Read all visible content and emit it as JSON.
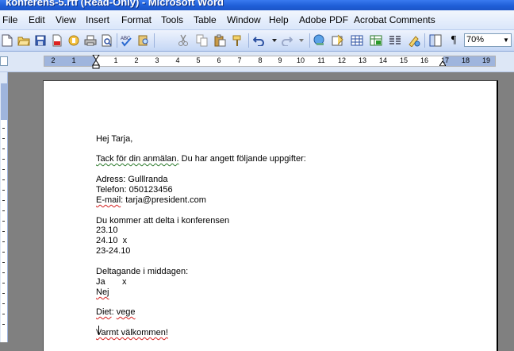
{
  "window": {
    "title": "konferens-5.rtf (Read-Only) - Microsoft Word"
  },
  "menu": {
    "items": [
      "File",
      "Edit",
      "View",
      "Insert",
      "Format",
      "Tools",
      "Table",
      "Window",
      "Help",
      "Adobe PDF",
      "Acrobat Comments"
    ]
  },
  "toolbar": {
    "zoom": "70%",
    "icons": [
      "new-doc-icon",
      "open-folder-icon",
      "save-icon",
      "pdf-icon",
      "permission-icon",
      "print-icon",
      "print-preview-icon",
      "spelling-icon",
      "research-icon",
      "cut-icon",
      "copy-icon",
      "paste-icon",
      "format-painter-icon",
      "undo-icon",
      "redo-icon",
      "hyperlink-icon",
      "tables-borders-icon",
      "insert-table-icon",
      "insert-excel-icon",
      "columns-icon",
      "drawing-icon",
      "document-map-icon",
      "show-formatting-icon"
    ]
  },
  "ruler": {
    "labels": [
      "2",
      "1",
      "1",
      "2",
      "3",
      "4",
      "5",
      "6",
      "7",
      "8",
      "9",
      "10",
      "11",
      "12",
      "13",
      "14",
      "15",
      "16",
      "17",
      "18",
      "19"
    ]
  },
  "document": {
    "lines": {
      "greeting": "Hej Tarja,",
      "thanks_a": "Tack för din anmälan.",
      "thanks_b": " Du har angett följande uppgifter:",
      "address": "Adress: Gulllranda",
      "phone": "Telefon: 050123456",
      "email_a": "E-mail",
      "email_b": ": tarja@president.com",
      "attend": "Du kommer att delta i konferensen",
      "d1": "23.10",
      "d2": "24.10  x",
      "d3": "23-24.10",
      "dinner": "Deltagande i middagen:",
      "yes": "Ja       x",
      "no": "Nej",
      "diet_a": "Diet",
      "diet_b": ": ",
      "diet_c": "vege",
      "welcome": "Varmt välkommen!"
    }
  },
  "colors": {
    "title_bar": "#1f5fd8",
    "menu_bg": "#dae6fa",
    "workspace": "#808080",
    "grammar_squiggle": "#2b7a2b",
    "spelling_squiggle": "#d42020"
  }
}
